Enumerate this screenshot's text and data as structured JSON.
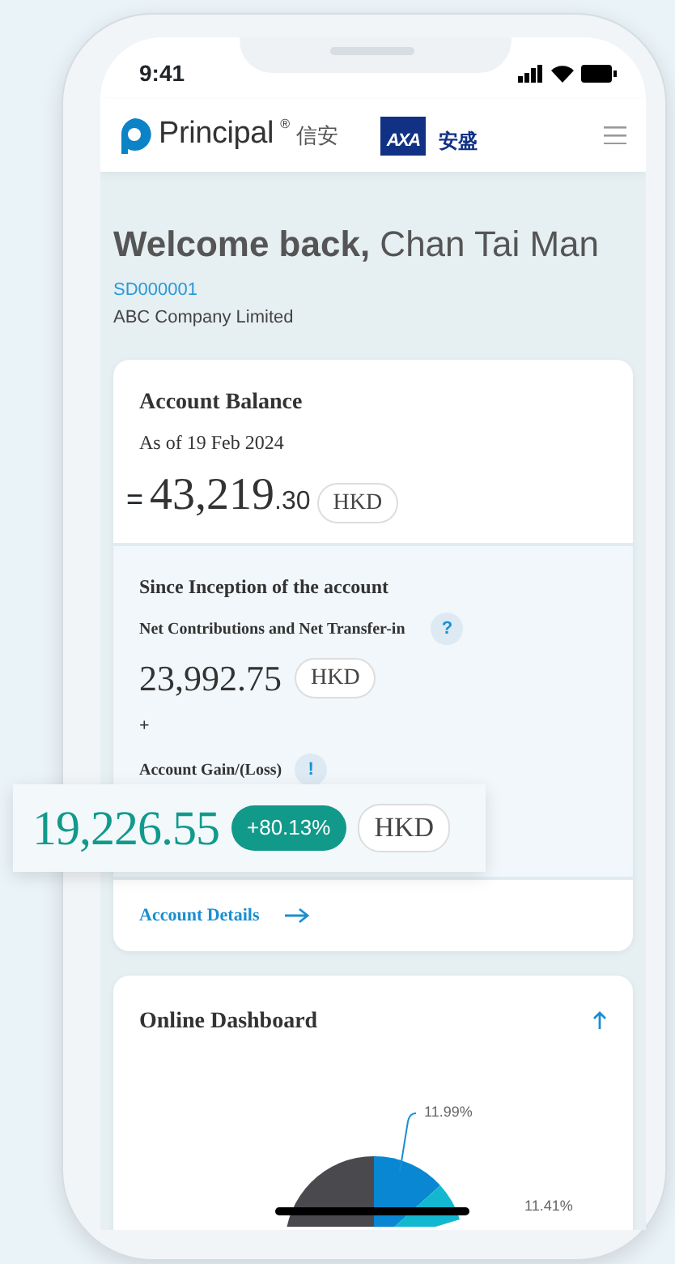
{
  "status_bar": {
    "time": "9:41"
  },
  "header": {
    "brand": "Principal",
    "brand_mark": "®",
    "brand_chinese": "信安",
    "partner_logo": "AXA",
    "partner_chinese": "安盛"
  },
  "welcome": {
    "greeting": "Welcome back,",
    "name": "Chan Tai Man",
    "scheme_id": "SD000001",
    "company": "ABC Company Limited"
  },
  "balance": {
    "title": "Account Balance",
    "as_of": "As of 19 Feb 2024",
    "prefix": "=",
    "whole": "43,219",
    "decimals": ".30",
    "currency": "HKD"
  },
  "inception": {
    "title": "Since Inception of the account",
    "contributions_label": "Net Contributions and Net Transfer-in",
    "contributions_help": "?",
    "contributions": "23,992.75",
    "contributions_currency": "HKD",
    "plus": "+",
    "gain_label": "Account Gain/(Loss)",
    "gain_help": "!",
    "gain": "19,226.55",
    "gain_pct": "+80.13%",
    "gain_currency": "HKD"
  },
  "details_link": "Account Details",
  "dashboard": {
    "title": "Online Dashboard",
    "slice_labels": [
      "11.99%",
      "11.41%"
    ]
  }
}
